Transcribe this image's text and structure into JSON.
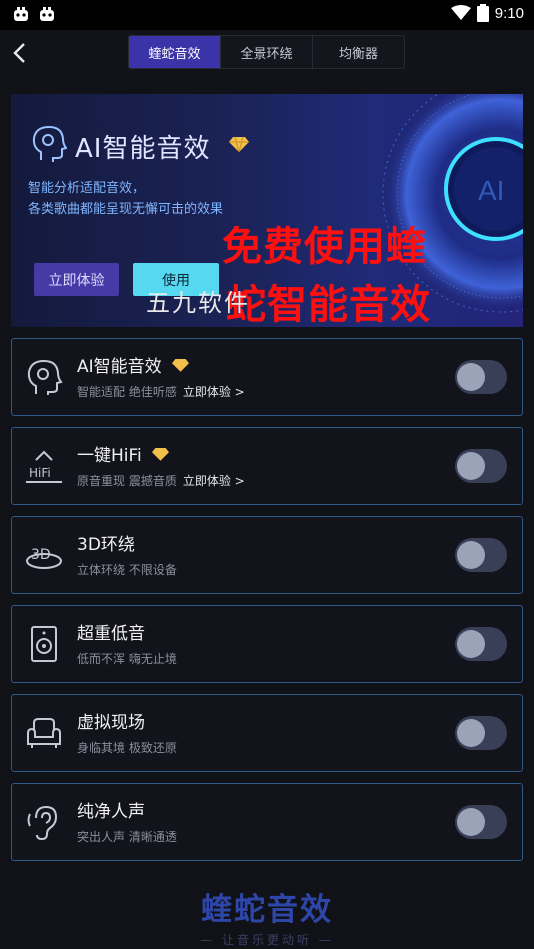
{
  "status_bar": {
    "time": "9:10"
  },
  "tabs": [
    {
      "label": "蝰蛇音效",
      "active": true
    },
    {
      "label": "全景环绕",
      "active": false
    },
    {
      "label": "均衡器",
      "active": false
    }
  ],
  "banner": {
    "title": "AI智能音效",
    "desc_line1": "智能分析适配音效，",
    "desc_line2": "各类歌曲都能呈现无懈可击的效果",
    "try_button": "立即体验",
    "use_button": "使用",
    "art_text": "AI"
  },
  "overlay": {
    "red_line1": "免费使用蝰",
    "red_line2": "蛇智能音效",
    "watermark": "五九软件"
  },
  "effects": [
    {
      "title": "AI智能音效",
      "premium": true,
      "subtitle": "智能适配 绝佳听感",
      "link": "立即体验 >",
      "icon": "ai-head-icon",
      "enabled": false
    },
    {
      "title": "一键HiFi",
      "premium": true,
      "subtitle": "原音重现 震撼音质",
      "link": "立即体验 >",
      "icon": "hifi-icon",
      "enabled": false
    },
    {
      "title": "3D环绕",
      "premium": false,
      "subtitle": "立体环绕 不限设备",
      "link": "",
      "icon": "3d-surround-icon",
      "enabled": false
    },
    {
      "title": "超重低音",
      "premium": false,
      "subtitle": "低而不浑 嗨无止境",
      "link": "",
      "icon": "speaker-icon",
      "enabled": false
    },
    {
      "title": "虚拟现场",
      "premium": false,
      "subtitle": "身临其境 极致还原",
      "link": "",
      "icon": "sofa-icon",
      "enabled": false
    },
    {
      "title": "纯净人声",
      "premium": false,
      "subtitle": "突出人声 清晰通透",
      "link": "",
      "icon": "ear-icon",
      "enabled": false
    }
  ],
  "footer": {
    "logo": "蝰蛇音效",
    "slogan": "— 让音乐更动听 —"
  },
  "colors": {
    "accent": "#3a34a8",
    "cyan": "#56d8f0",
    "card_border": "#2d5a88",
    "overlay_red": "#ff1010"
  }
}
